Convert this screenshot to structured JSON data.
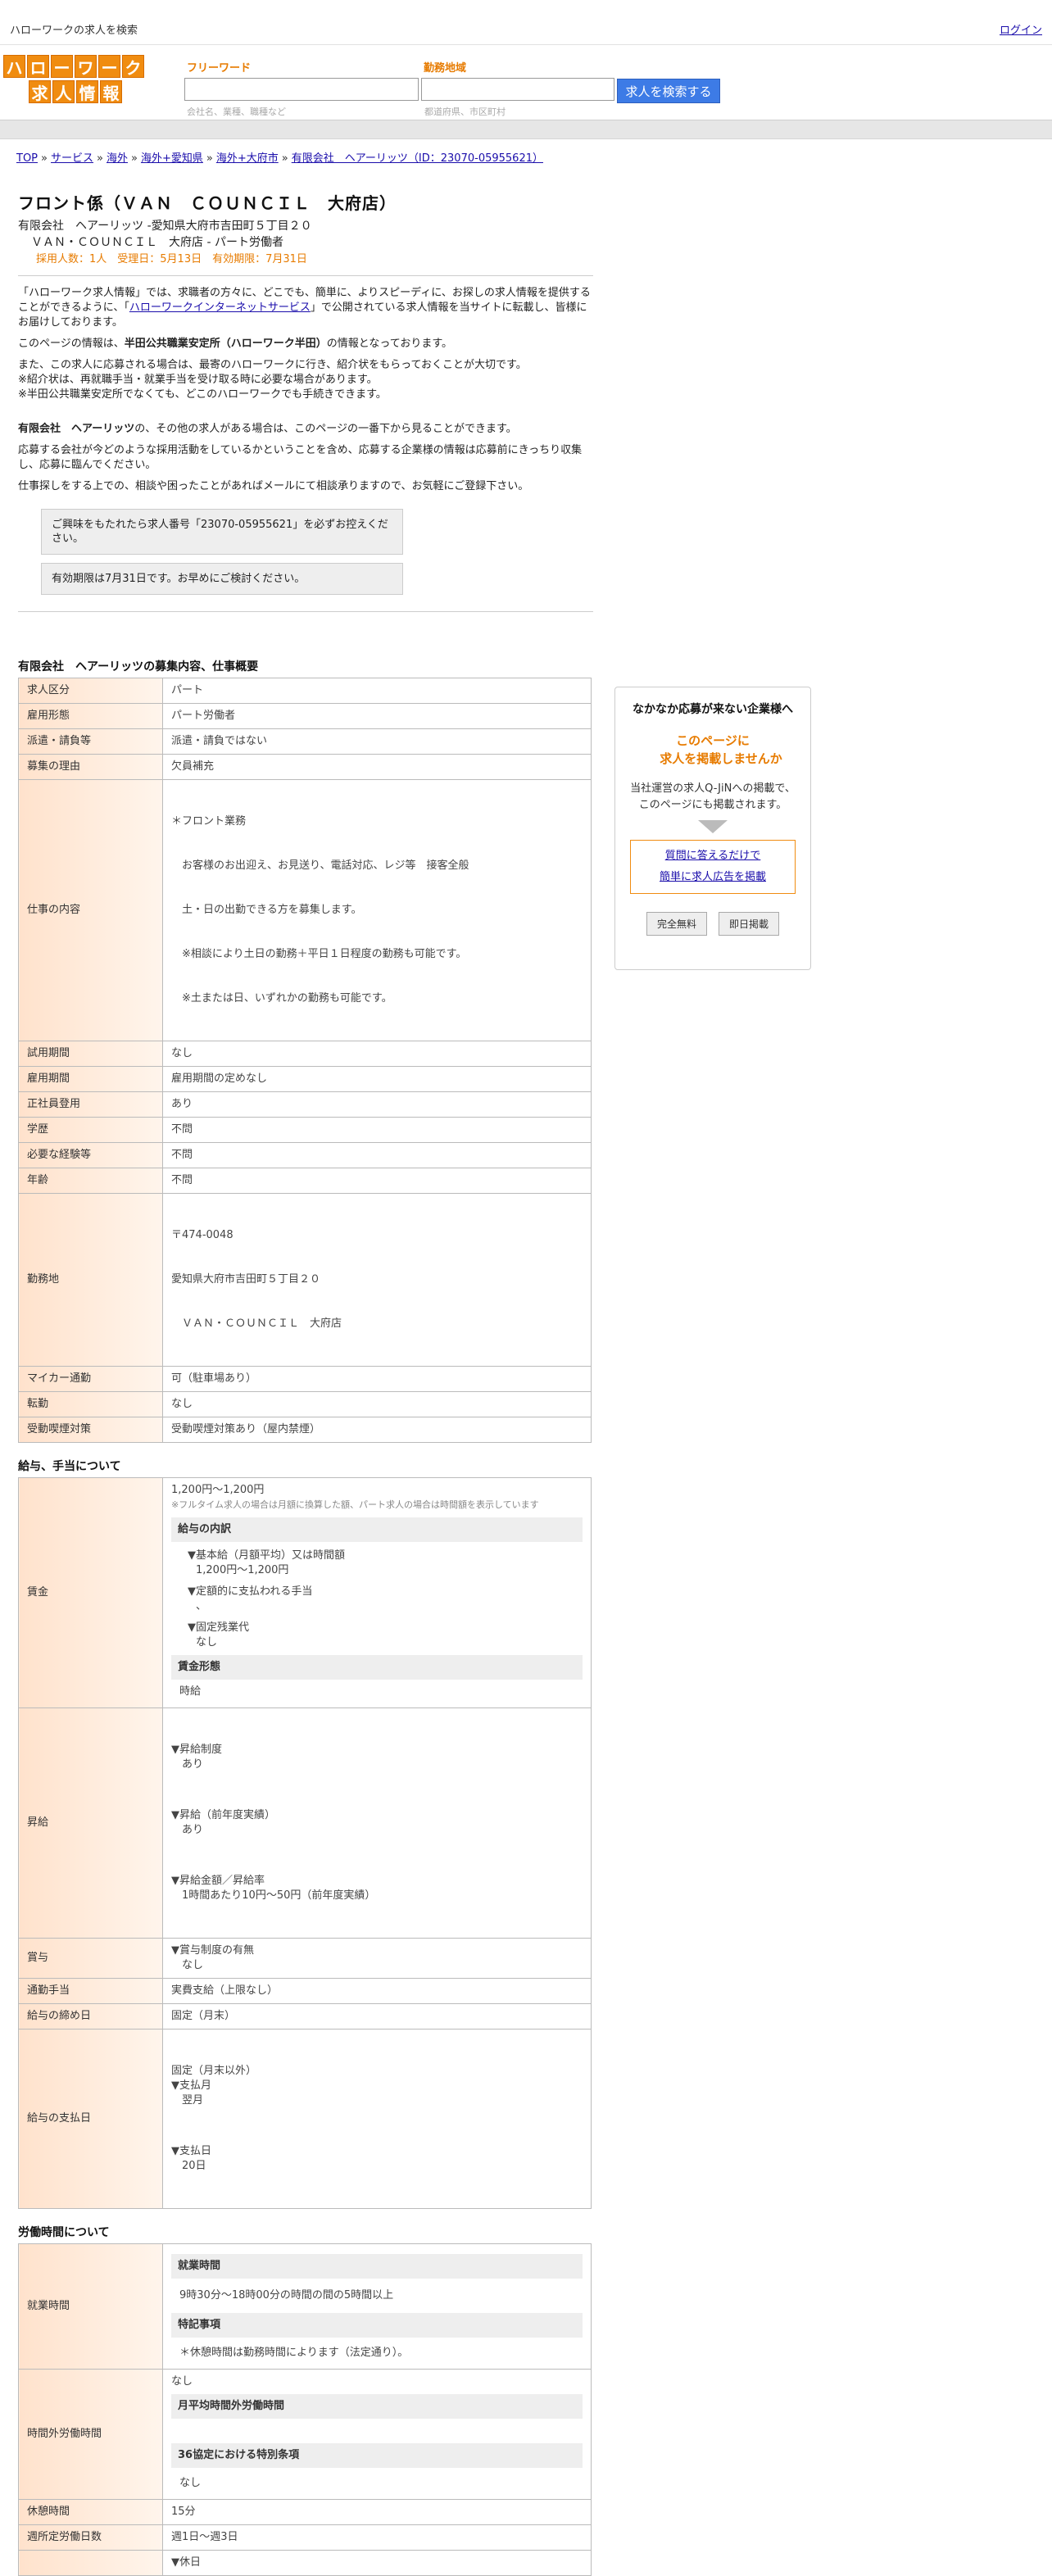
{
  "topbar": {
    "site_title": "ハローワークの求人を検索",
    "login": "ログイン"
  },
  "logo": {
    "row1": [
      "ハ",
      "ロ",
      "ー",
      "ワ",
      "ー",
      "ク"
    ],
    "row2": [
      "求",
      "人",
      "情",
      "報"
    ]
  },
  "search": {
    "keyword_label": "フリーワード",
    "keyword_hint": "会社名、業種、職種など",
    "area_label": "勤務地域",
    "area_hint": "都道府県、市区町村",
    "button": "求人を検索する"
  },
  "breadcrumb": [
    "TOP",
    "サービス",
    "海外",
    "海外+愛知県",
    "海外+大府市",
    "有限会社　ヘアーリッツ（ID：23070-05955621）"
  ],
  "job": {
    "title": "フロント係（ＶＡＮ　ＣＯＵＮＣＩＬ　大府店）",
    "company_line": "有限会社　ヘアーリッツ -愛知県大府市吉田町５丁目２０",
    "store_line": "ＶＡＮ・ＣＯＵＮＣＩＬ　大府店 - パート労働者",
    "meta_line": "採用人数：1人　受理日：5月13日　有効期限：7月31日"
  },
  "intro": {
    "p1a": "「ハローワーク求人情報」では、求職者の方々に、どこでも、簡単に、よりスピーディに、お探しの求人情報を提供することができるように、「",
    "p1link": "ハローワークインターネットサービス",
    "p1b": "」で公開されている求人情報を当サイトに転載し、皆様にお届けしております。",
    "p2a": "このページの情報は、",
    "p2b": "半田公共職業安定所（ハローワーク半田）",
    "p2c": "の情報となっております。",
    "p3": "また、この求人に応募される場合は、最寄のハローワークに行き、紹介状をもらっておくことが大切です。",
    "p3n1": "※紹介状は、再就職手当・就業手当を受け取る時に必要な場合があります。",
    "p3n2": "※半田公共職業安定所でなくても、どこのハローワークでも手続きできます。",
    "p4a": "有限会社　ヘアーリッツ",
    "p4b": "の、その他の求人がある場合は、このページの一番下から見ることができます。",
    "p5": "応募する会社が今どのような採用活動をしているかということを含め、応募する企業様の情報は応募前にきっちり収集し、応募に臨んでください。",
    "p6": "仕事探しをする上での、相談や困ったことがあればメールにて相談承りますので、お気軽にご登録下さい。",
    "note1": "ご興味をもたれたら求人番号「23070-05955621」を必ずお控えください。",
    "note2": "有効期限は7月31日です。お早めにご検討ください。"
  },
  "sec1": {
    "heading": "有限会社　ヘアーリッツの募集内容、仕事概要",
    "rows": [
      {
        "k": "求人区分",
        "v": "パート"
      },
      {
        "k": "雇用形態",
        "v": "パート労働者"
      },
      {
        "k": "派遣・請負等",
        "v": "派遣・請負ではない"
      },
      {
        "k": "募集の理由",
        "v": "欠員補充"
      }
    ],
    "work_k": "仕事の内容",
    "work_lines": [
      "＊フロント業務",
      "　お客様のお出迎え、お見送り、電話対応、レジ等　接客全般",
      "　土・日の出勤できる方を募集します。",
      "　※相談により土日の勤務＋平日１日程度の勤務も可能です。",
      "　※土または日、いずれかの勤務も可能です。"
    ],
    "rows2": [
      {
        "k": "試用期間",
        "v": "なし"
      },
      {
        "k": "雇用期間",
        "v": "雇用期間の定めなし"
      },
      {
        "k": "正社員登用",
        "v": "あり"
      },
      {
        "k": "学歴",
        "v": "不問"
      },
      {
        "k": "必要な経験等",
        "v": "不問"
      },
      {
        "k": "年齢",
        "v": "不問"
      }
    ],
    "loc_k": "勤務地",
    "loc_lines": [
      "〒474-0048",
      "愛知県大府市吉田町５丁目２０",
      "　ＶＡＮ・ＣＯＵＮＣＩＬ　大府店"
    ],
    "rows3": [
      {
        "k": "マイカー通勤",
        "v": "可（駐車場あり）"
      },
      {
        "k": "転勤",
        "v": "なし"
      },
      {
        "k": "受動喫煙対策",
        "v": "受動喫煙対策あり（屋内禁煙）"
      }
    ]
  },
  "sec2": {
    "heading": "給与、手当について",
    "wage_k": "賃金",
    "wage_range": "1,200円〜1,200円",
    "wage_note": "※フルタイム求人の場合は月額に換算した額、パート求人の場合は時間額を表示しています",
    "breakdown_h": "給与の内訳",
    "base_label": "▼基本給（月額平均）又は時間額",
    "base_value": "1,200円〜1,200円",
    "fixed_label": "▼定額的に支払われる手当",
    "fixed_value": "、",
    "ot_label": "▼固定残業代",
    "ot_value": "なし",
    "form_h": "賃金形態",
    "form_value": "時給",
    "raise_k": "昇給",
    "raise_lines": [
      "▼昇給制度",
      "　あり",
      "▼昇給（前年度実績）",
      "　あり",
      "▼昇給金額／昇給率",
      "　1時間あたり10円〜50円（前年度実績）"
    ],
    "bonus_k": "賞与",
    "bonus_lines": [
      "▼賞与制度の有無",
      "　なし"
    ],
    "commute_k": "通勤手当",
    "commute_v": "実費支給（上限なし）",
    "close_k": "給与の締め日",
    "close_v": "固定（月末）",
    "pay_k": "給与の支払日",
    "pay_lines": [
      "固定（月末以外）",
      "▼支払月",
      "　翌月",
      "▼支払日",
      "　20日"
    ]
  },
  "sec3": {
    "heading": "労働時間について",
    "hours_k": "就業時間",
    "hours_h": "就業時間",
    "hours_v": "9時30分〜18時00分の時間の間の5時間以上",
    "special_h": "特記事項",
    "special_v": "＊休憩時間は勤務時間によります（法定通り）。",
    "ot_k": "時間外労働時間",
    "ot_v": "なし",
    "ot_avg_h": "月平均時間外労働時間",
    "ot36_h": "36協定における特別条項",
    "ot36_v": "なし",
    "break_k": "休憩時間",
    "break_v": "15分",
    "days_k": "週所定労働日数",
    "days_v": "週1日〜週3日",
    "holiday_v": "▼休日"
  },
  "sidebar": {
    "title": "なかなか応募が来ない企業様へ",
    "catch1": "このページに",
    "catch2": "求人を掲載しませんか",
    "desc1": "当社運営の求人Q-JiNへの掲載で、",
    "desc2": "このページにも掲載されます。",
    "link1": "質問に答えるだけで",
    "link2": "簡単に求人広告を掲載",
    "btn1": "完全無料",
    "btn2": "即日掲載"
  }
}
